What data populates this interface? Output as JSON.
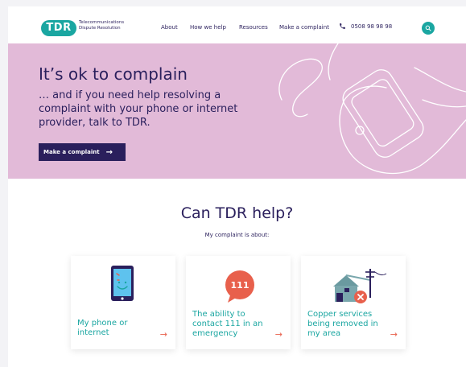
{
  "header": {
    "logo_text": "TDR",
    "logo_sub_1": "Telecommunications",
    "logo_sub_2": "Dispute Resolution",
    "nav": [
      "About",
      "How we help",
      "Resources",
      "Make a complaint"
    ],
    "phone": "0508 98 98 98"
  },
  "hero": {
    "title": "It’s ok to complain",
    "subtitle": "… and if you need help resolving a complaint with your phone or internet provider, talk to TDR.",
    "button_label": "Make a complaint",
    "button_arrow": "→"
  },
  "section": {
    "title": "Can TDR help?",
    "subtitle": "My complaint is about:"
  },
  "cards": [
    {
      "label": "My phone or internet",
      "arrow": "→",
      "icon": "phone-smile-icon"
    },
    {
      "label": "The ability to contact 111 in an emergency",
      "arrow": "→",
      "icon": "speech-bubble-111-icon",
      "badge": "111"
    },
    {
      "label": "Copper services being removed in my area",
      "arrow": "→",
      "icon": "house-power-pole-icon"
    }
  ],
  "colors": {
    "teal": "#1aa6a1",
    "navy": "#2a1f5c",
    "pink": "#e2bad8",
    "coral": "#e8604c"
  }
}
